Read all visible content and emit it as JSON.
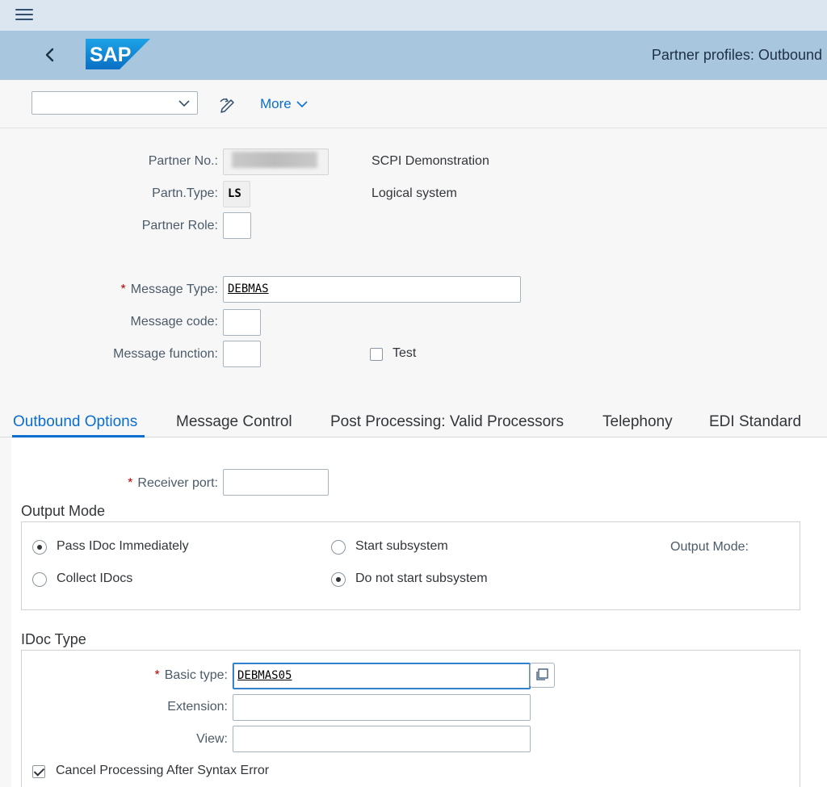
{
  "shell": {
    "page_title": "Partner profiles: Outbound",
    "logo_text": "SAP"
  },
  "toolbar": {
    "command_value": "",
    "more_label": "More"
  },
  "header": {
    "partner_no_label": "Partner No.:",
    "partner_no_desc": "SCPI Demonstration",
    "partn_type_label": "Partn.Type:",
    "partn_type_value": "LS",
    "partn_type_desc": "Logical system",
    "partner_role_label": "Partner Role:",
    "partner_role_value": "",
    "message_type_label": "Message Type:",
    "message_type_value": "DEBMAS",
    "message_code_label": "Message code:",
    "message_code_value": "",
    "message_function_label": "Message function:",
    "message_function_value": "",
    "test_label": "Test",
    "test_checked": false
  },
  "tabs": [
    {
      "label": "Outbound Options",
      "active": true
    },
    {
      "label": "Message Control",
      "active": false
    },
    {
      "label": "Post Processing: Valid Processors",
      "active": false
    },
    {
      "label": "Telephony",
      "active": false
    },
    {
      "label": "EDI Standard",
      "active": false
    }
  ],
  "outbound": {
    "receiver_port_label": "Receiver port:",
    "receiver_port_value": "",
    "output_mode_title": "Output Mode",
    "pass_immediately_label": "Pass IDoc Immediately",
    "collect_idocs_label": "Collect IDocs",
    "start_subsystem_label": "Start subsystem",
    "do_not_start_label": "Do not start subsystem",
    "output_mode_label": "Output Mode:",
    "idoc_type_title": "IDoc Type",
    "basic_type_label": "Basic type:",
    "basic_type_value": "DEBMAS05",
    "extension_label": "Extension:",
    "extension_value": "",
    "view_label": "View:",
    "view_value": "",
    "cancel_processing_label": "Cancel Processing After Syntax Error",
    "cancel_processing_checked": true
  },
  "colors": {
    "accent": "#0a6ed1",
    "shellbar": "#a8c7df",
    "topbar": "#dbe6f1",
    "required": "#bb0000"
  }
}
